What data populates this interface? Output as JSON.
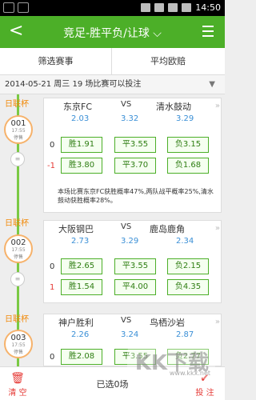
{
  "status": {
    "time": "14:50"
  },
  "header": {
    "back": "<",
    "title": "竞足-胜平负/让球 ⌵"
  },
  "tabs": [
    "筛选赛事",
    "平均欧赔"
  ],
  "date_text": "2014-05-21 周三 19 场比赛可以投注",
  "matches": [
    {
      "league": "日联杯",
      "num": "001",
      "time": "17:55",
      "status": "停售",
      "home": "东京FC",
      "vs": "VS",
      "away": "清水鼓动",
      "odds": [
        "2.03",
        "3.32",
        "3.29"
      ],
      "rows": [
        {
          "hc": "0",
          "cells": [
            "胜1.91",
            "平3.55",
            "负3.15"
          ]
        },
        {
          "hc": "-1",
          "cells": [
            "胜3.80",
            "平3.70",
            "负1.68"
          ]
        }
      ],
      "memo": "本场比赛东京FC获胜概率47%,两队战平概率25%,清水鼓动获胜概率28%。"
    },
    {
      "league": "日联杯",
      "num": "002",
      "time": "17:55",
      "status": "停售",
      "home": "大阪钢巴",
      "vs": "VS",
      "away": "鹿岛鹿角",
      "odds": [
        "2.73",
        "3.29",
        "2.34"
      ],
      "rows": [
        {
          "hc": "0",
          "cells": [
            "胜2.65",
            "平3.55",
            "负2.15"
          ]
        },
        {
          "hc": "1",
          "cells": [
            "胜1.54",
            "平4.00",
            "负4.35"
          ]
        }
      ]
    },
    {
      "league": "日联杯",
      "num": "003",
      "time": "17:55",
      "status": "停售",
      "home": "神户胜利",
      "vs": "VS",
      "away": "鸟栖沙岩",
      "odds": [
        "2.26",
        "3.24",
        "2.87"
      ],
      "rows": [
        {
          "hc": "0",
          "cells": [
            "胜2.08",
            "平3.55",
            "负2.77"
          ]
        }
      ]
    }
  ],
  "bottom": {
    "clear": "清 空",
    "selected": "已选0场",
    "submit": "投 注"
  },
  "watermark": {
    "title": "KK下载",
    "url": "www.kkx.net"
  },
  "colors": {
    "green": "#4caf28",
    "orange": "#f28a0a",
    "blue": "#3a8fd6",
    "red": "#e53935"
  }
}
